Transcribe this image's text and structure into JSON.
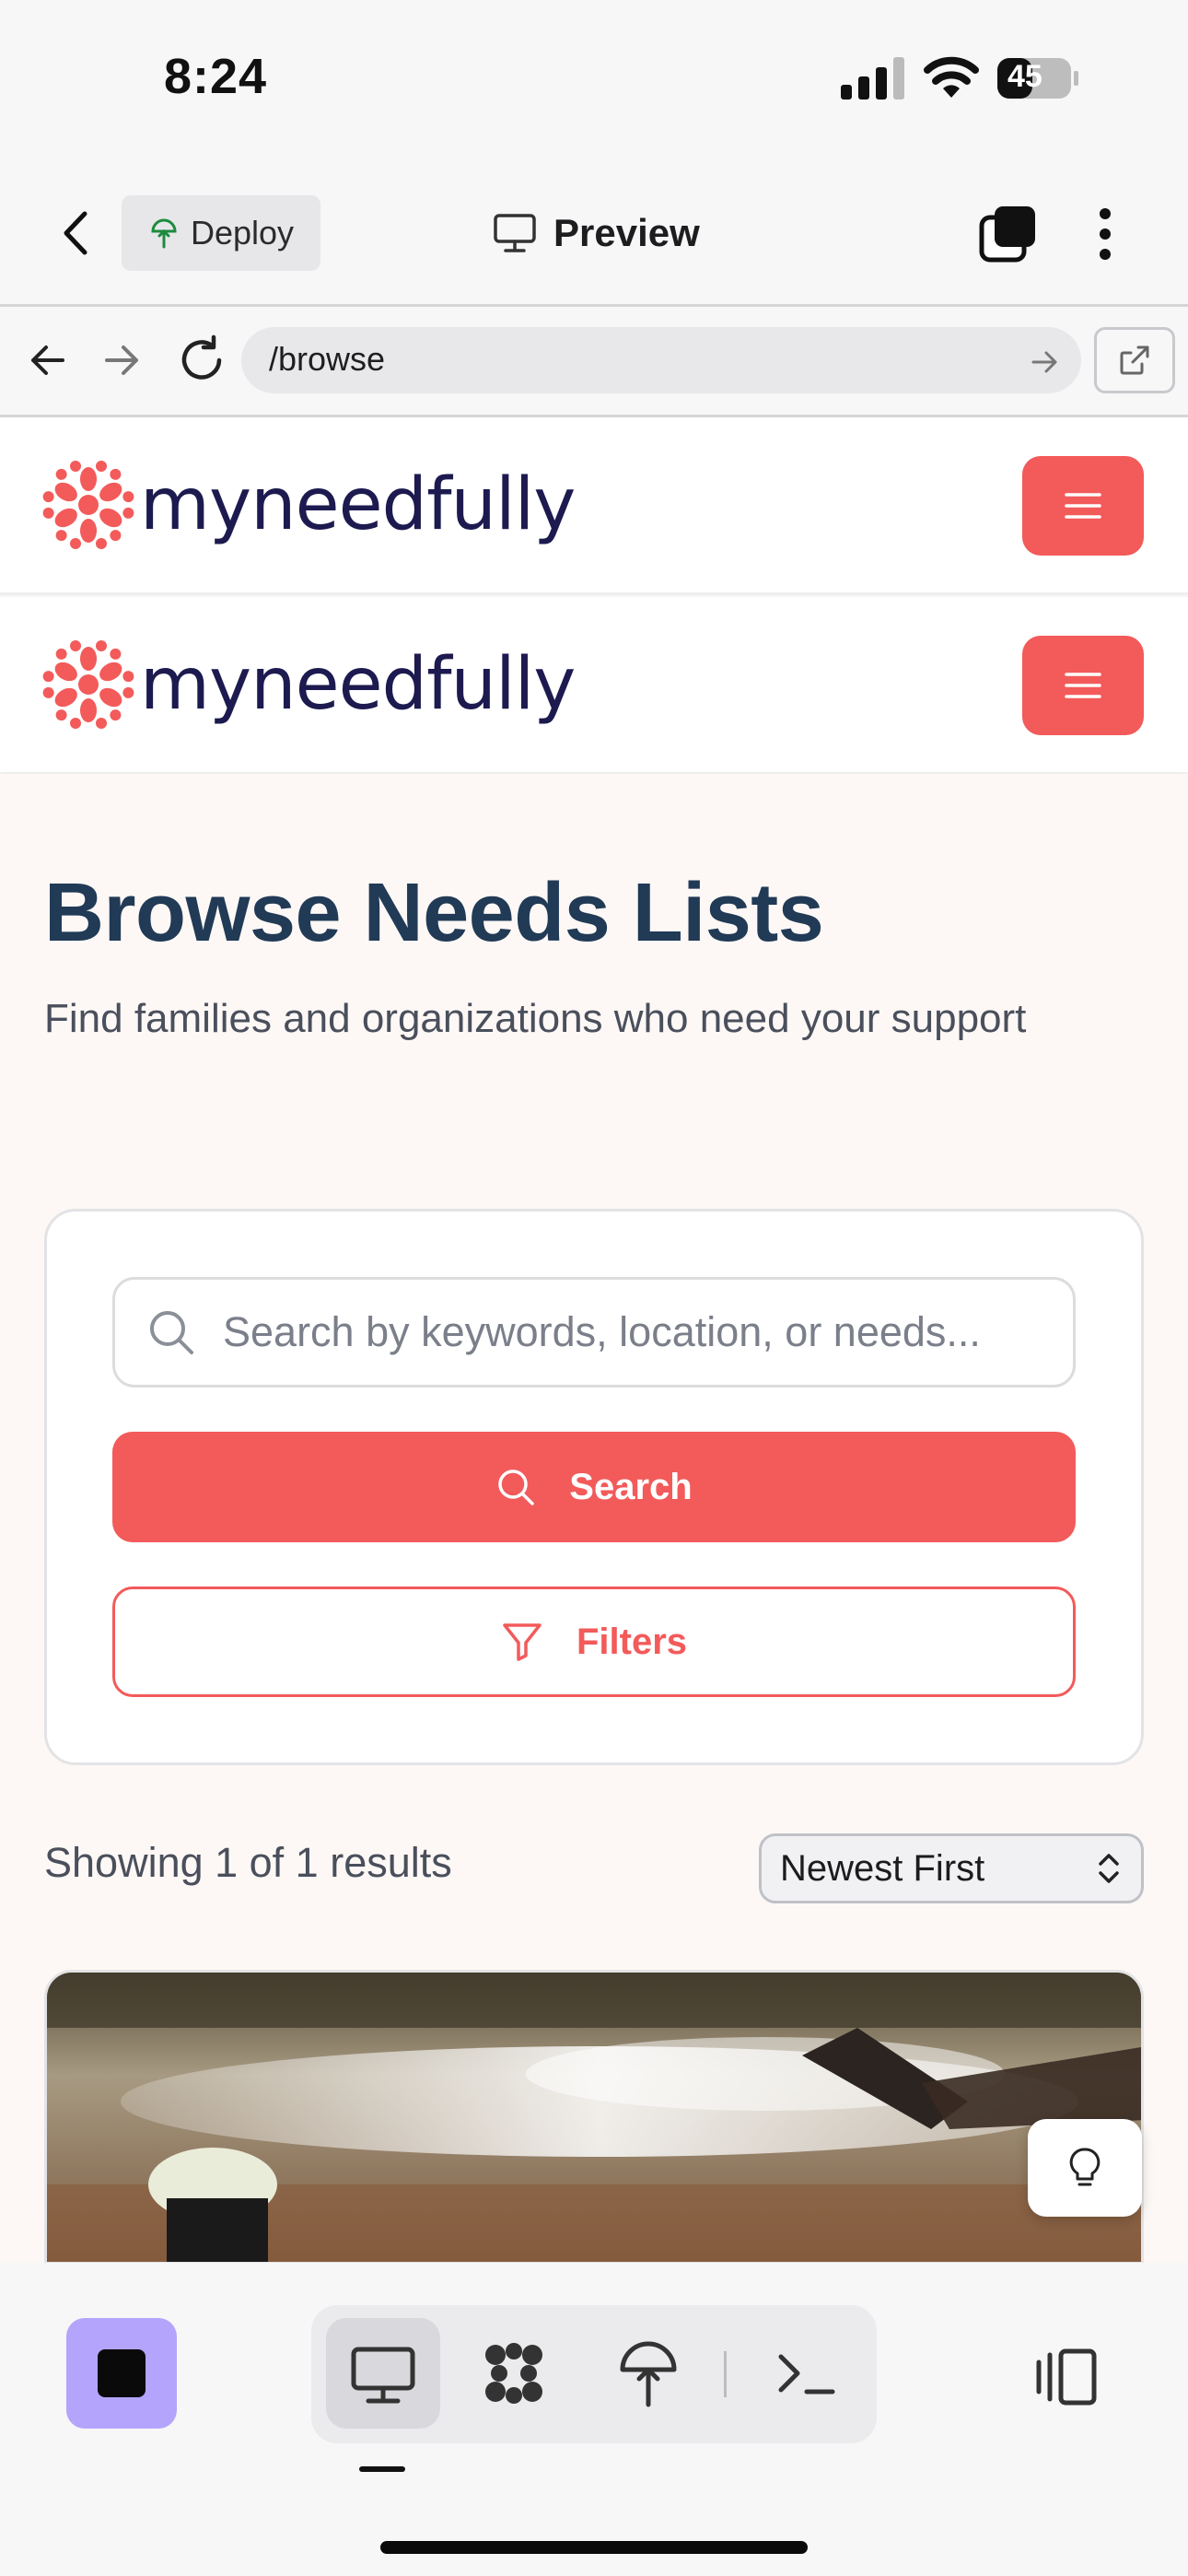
{
  "status_bar": {
    "time": "8:24",
    "battery": "45"
  },
  "app_header": {
    "deploy_label": "Deploy",
    "preview_label": "Preview"
  },
  "browser": {
    "url": "/browse"
  },
  "site": {
    "logo_text": "myneedfully",
    "brand_color": "#f35a5a",
    "navy_color": "#1c1a4f"
  },
  "page": {
    "title": "Browse Needs Lists",
    "subtitle": "Find families and organizations who need your support"
  },
  "search": {
    "placeholder": "Search by keywords, location, or needs...",
    "value": "",
    "search_button_label": "Search",
    "filters_button_label": "Filters"
  },
  "results": {
    "count_text": "Showing 1 of 1 results",
    "sort_selected": "Newest First"
  },
  "toolbar": {
    "icons": [
      "monitor-icon",
      "agent-icon",
      "deploy-icon",
      "terminal-icon"
    ],
    "active": "monitor-icon"
  }
}
